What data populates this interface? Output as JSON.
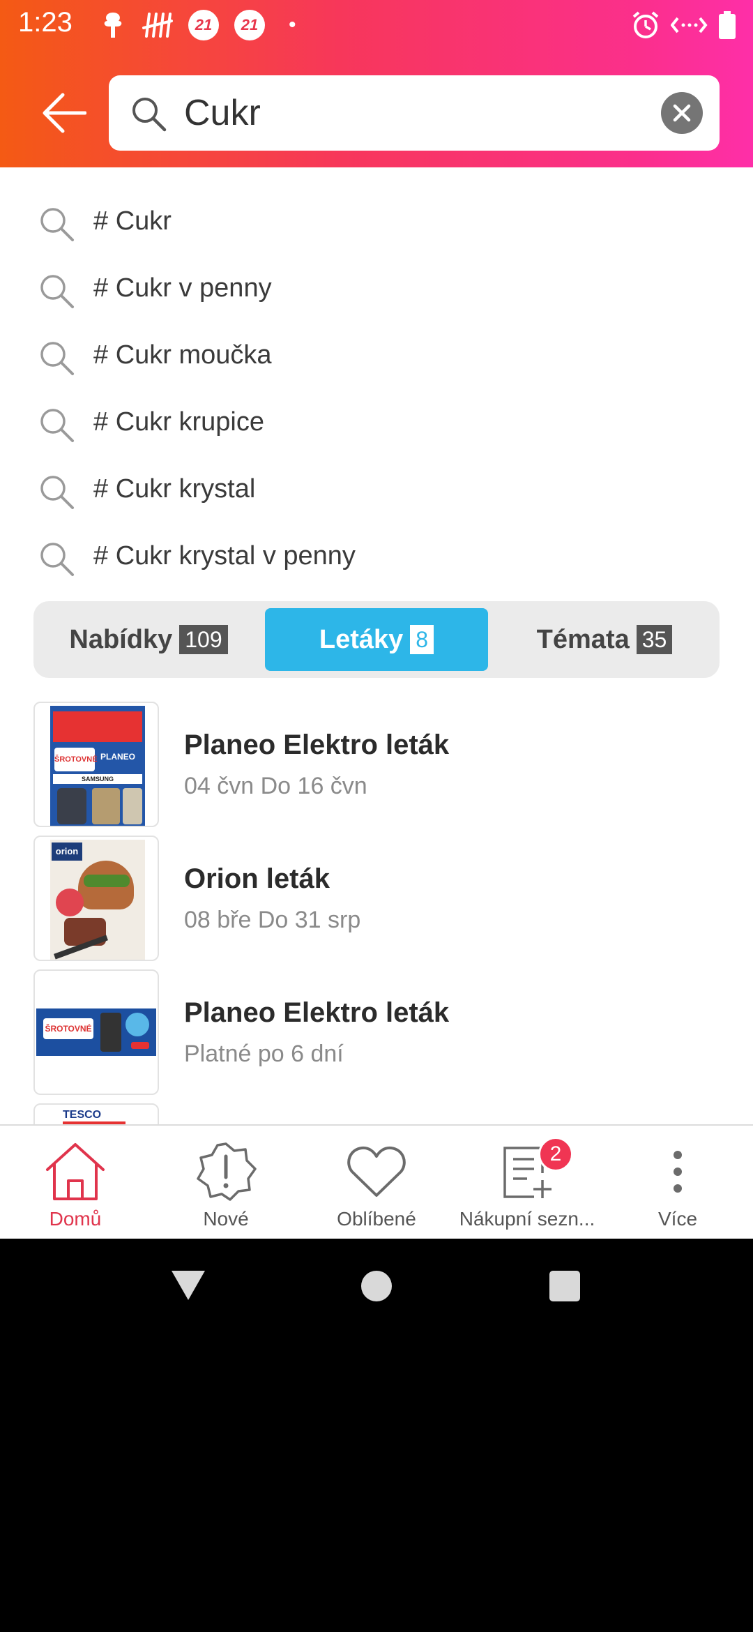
{
  "status_bar": {
    "time": "1:23",
    "badge_1": "21",
    "badge_2": "21",
    "dot": "•"
  },
  "search": {
    "query": "Cukr",
    "placeholder": ""
  },
  "suggestions": [
    {
      "label": "# Cukr"
    },
    {
      "label": "# Cukr v penny"
    },
    {
      "label": "# Cukr moučka"
    },
    {
      "label": "# Cukr krupice"
    },
    {
      "label": "# Cukr krystal"
    },
    {
      "label": "# Cukr krystal v penny"
    }
  ],
  "tabs": [
    {
      "label": "Nabídky",
      "count": "109",
      "active": false
    },
    {
      "label": "Letáky",
      "count": "8",
      "active": true
    },
    {
      "label": "Témata",
      "count": "35",
      "active": false
    }
  ],
  "flyers": [
    {
      "title": "Planeo Elektro leták",
      "subtitle": "04 čvn Do 16 čvn",
      "thumb_text_1": "ŠROTOVNÉ",
      "thumb_text_2": "PLANEO",
      "thumb_text_3": "SAMSUNG"
    },
    {
      "title": "Orion leták",
      "subtitle": "08 bře Do 31 srp",
      "thumb_text_1": "orion"
    },
    {
      "title": "Planeo Elektro leták",
      "subtitle": "Platné po 6 dní",
      "thumb_text_1": "ŠROTOVNÉ"
    },
    {
      "thumb_text_1": "TESCO"
    }
  ],
  "bottom_nav": [
    {
      "label": "Domů",
      "icon": "home-icon",
      "active": true
    },
    {
      "label": "Nové",
      "icon": "new-badge-icon",
      "active": false
    },
    {
      "label": "Oblíbené",
      "icon": "heart-icon",
      "active": false
    },
    {
      "label": "Nákupní sezn...",
      "icon": "shopping-list-icon",
      "active": false,
      "badge": "2"
    },
    {
      "label": "Více",
      "icon": "more-vertical-icon",
      "active": false
    }
  ],
  "colors": {
    "header_start": "#f45a14",
    "header_end": "#fe2fa8",
    "active_tab": "#2db6e8",
    "active_nav": "#e0344c",
    "badge": "#f03553"
  }
}
